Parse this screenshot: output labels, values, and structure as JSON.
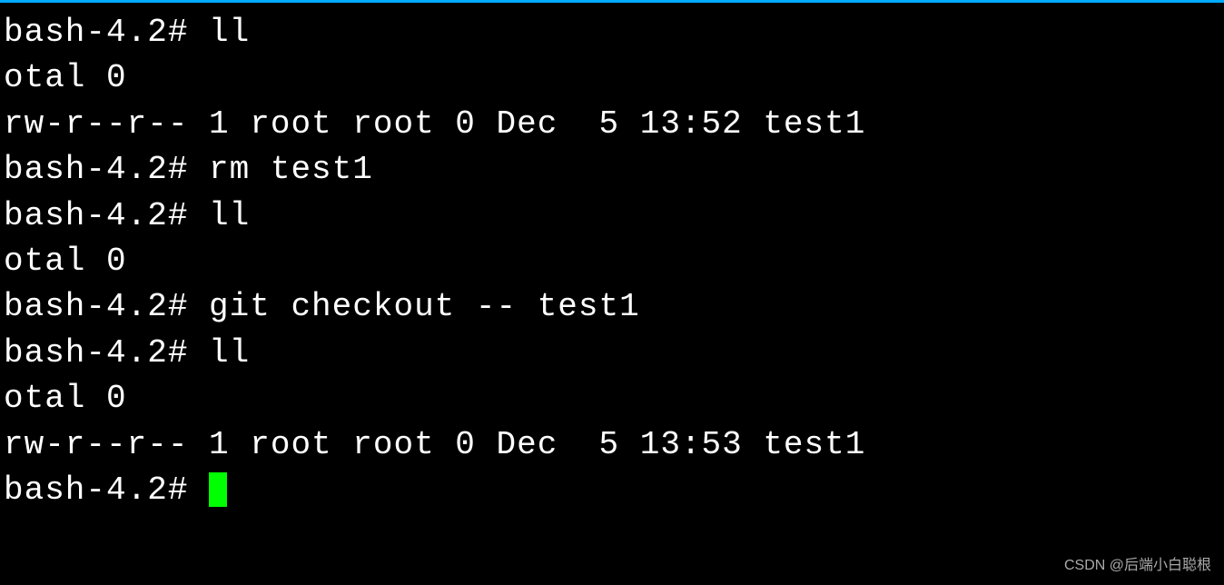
{
  "terminal": {
    "lines": [
      "bash-4.2# ll",
      "otal 0",
      "rw-r--r-- 1 root root 0 Dec  5 13:52 test1",
      "bash-4.2# rm test1",
      "bash-4.2# ll",
      "otal 0",
      "bash-4.2# git checkout -- test1",
      "bash-4.2# ll",
      "otal 0",
      "rw-r--r-- 1 root root 0 Dec  5 13:53 test1"
    ],
    "prompt": "bash-4.2# "
  },
  "watermark": "CSDN @后端小白聪根"
}
